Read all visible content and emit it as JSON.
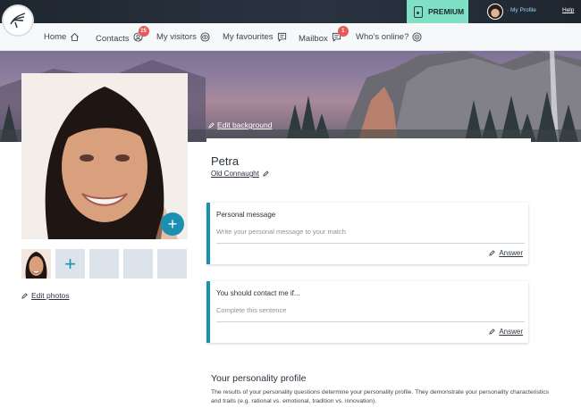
{
  "header": {
    "premium_label": "PREMIUM",
    "my_profile_label": "· My Profile",
    "help_label": "Help"
  },
  "nav": {
    "items": [
      {
        "label": "Home",
        "icon": "home-icon"
      },
      {
        "label": "Contacts",
        "icon": "contacts-icon",
        "badge": "15"
      },
      {
        "label": "My visitors",
        "icon": "visitors-icon"
      },
      {
        "label": "My favourites",
        "icon": "favourites-icon"
      },
      {
        "label": "Mailbox",
        "icon": "mailbox-icon",
        "badge": "1"
      },
      {
        "label": "Who's online?",
        "icon": "online-icon"
      }
    ]
  },
  "banner": {
    "edit_background_label": "Edit background"
  },
  "photos": {
    "edit_photos_label": "Edit photos"
  },
  "profile": {
    "name": "Petra",
    "location": "Old Connaught"
  },
  "personal_message": {
    "title": "Personal message",
    "placeholder": "Write your personal message to your match",
    "answer_label": "Answer"
  },
  "contact_me": {
    "title": "You should contact me if...",
    "placeholder": "Complete this sentence",
    "answer_label": "Answer"
  },
  "personality": {
    "title": "Your personality profile",
    "text": "The results of your personality questions determine your personality profile. They demonstrate your personality characteristics and traits (e.g. rational vs. emotional, tradition vs. innovation)."
  },
  "colors": {
    "accent": "#1b90b2",
    "premium_bg": "#7fe0c6",
    "badge": "#e85a5a",
    "topbar": "#232b36"
  }
}
